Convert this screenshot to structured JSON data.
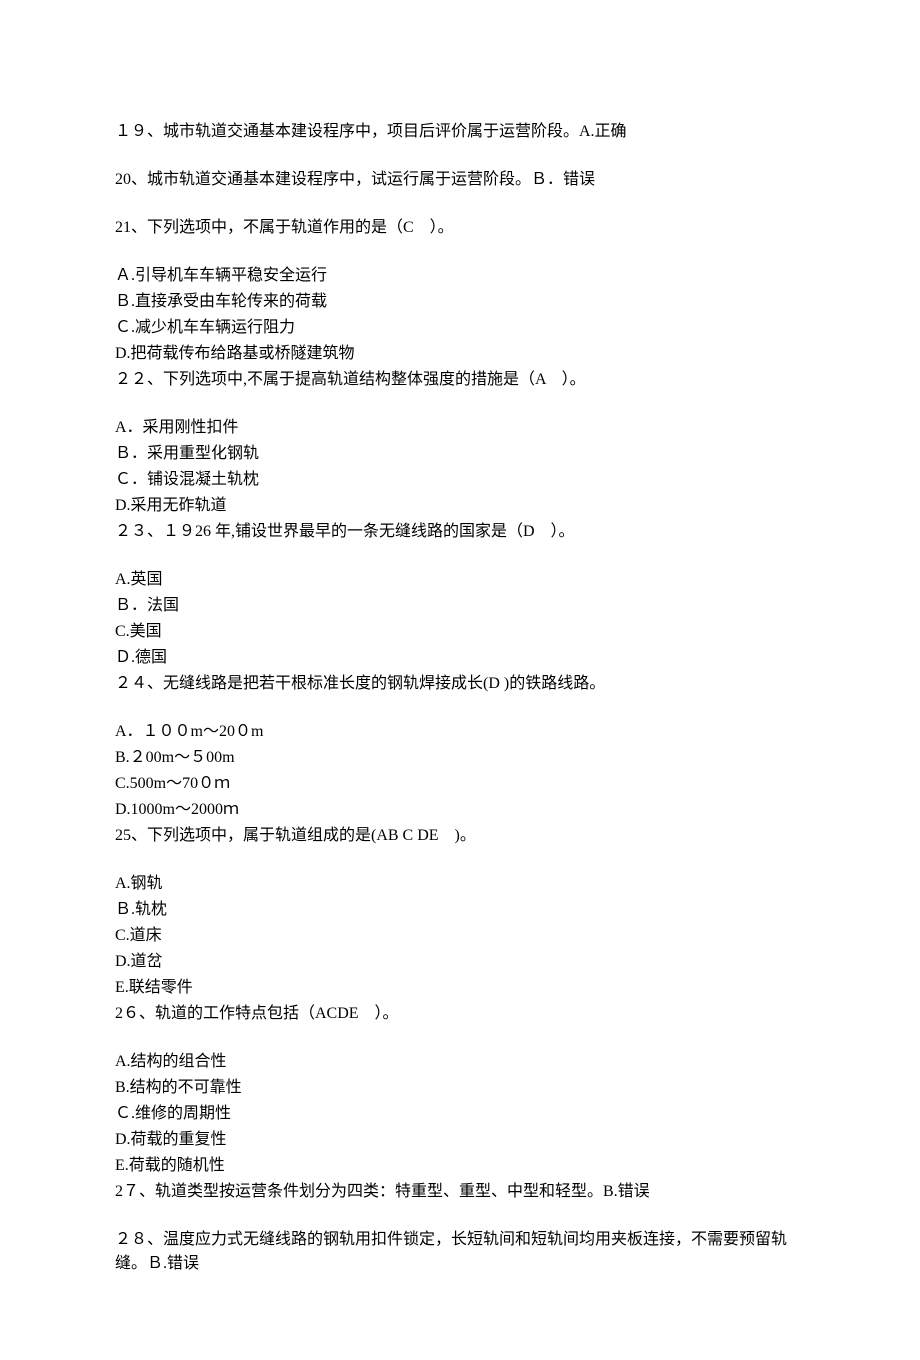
{
  "q19": "１９、城市轨道交通基本建设程序中，项目后评价属于运营阶段。A.正确",
  "q20": "20、城市轨道交通基本建设程序中，试运行属于运营阶段。Ｂ．错误",
  "q21": "21、下列选项中，不属于轨道作用的是（C　）。",
  "q21a": "Ａ.引导机车车辆平稳安全运行",
  "q21b": "Ｂ.直接承受由车轮传来的荷载",
  "q21c": "Ｃ.减少机车车辆运行阻力",
  "q21d": "D.把荷载传布给路基或桥隧建筑物",
  "q22": "２２、下列选项中,不属于提高轨道结构整体强度的措施是（A　）。",
  "q22a": "A．采用刚性扣件",
  "q22b": "Ｂ．采用重型化钢轨",
  "q22c": "Ｃ．铺设混凝土轨枕",
  "q22d": "D.采用无砟轨道",
  "q23": "２３、１９26 年,铺设世界最早的一条无缝线路的国家是（D　）。",
  "q23a": "A.英国",
  "q23b": "Ｂ．法国",
  "q23c": "C.美国",
  "q23d": "Ｄ.德国",
  "q24": "２４、无缝线路是把若干根标准长度的钢轨焊接成长(D )的铁路线路。",
  "q24a": "A．１００m～20０m",
  "q24b": "B.２00m～５00m",
  "q24c": "C.500m～70０ｍ",
  "q24d": "D.1000m～2000ｍ",
  "q25": "25、下列选项中，属于轨道组成的是(AB C DE　)。",
  "q25a": "A.钢轨",
  "q25b": "Ｂ.轨枕",
  "q25c": "C.道床",
  "q25d": "D.道岔",
  "q25e": "E.联结零件",
  "q26": "2６、轨道的工作特点包括（ACDE　）。",
  "q26a": "A.结构的组合性",
  "q26b": "B.结构的不可靠性",
  "q26c": "Ｃ.维修的周期性",
  "q26d": "D.荷载的重复性",
  "q26e": "E.荷载的随机性",
  "q27": "2７、轨道类型按运营条件划分为四类：特重型、重型、中型和轻型。B.错误",
  "q28": "２８、温度应力式无缝线路的钢轨用扣件锁定，长短轨间和短轨间均用夹板连接，不需要预留轨缝。Ｂ.错误"
}
